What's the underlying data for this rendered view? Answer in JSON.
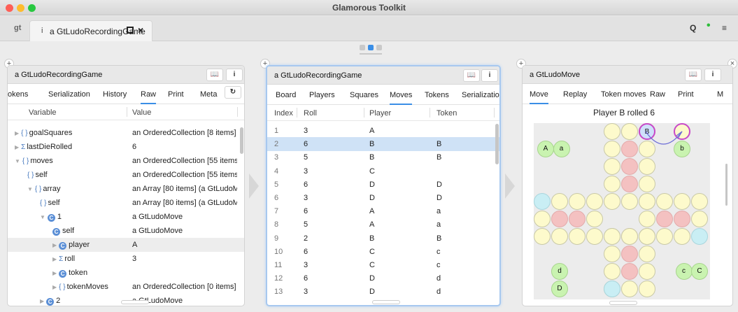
{
  "window": {
    "title": "Glamorous Toolkit",
    "traffic": [
      "#fe5f57",
      "#febc2e",
      "#28c840"
    ]
  },
  "app": {
    "logo": "gt"
  },
  "main_tab": {
    "icon": "i",
    "label": "a GtLudoRecordingGame",
    "maximize_icon": "square-icon",
    "close_icon": "×"
  },
  "toolbar": {
    "search": "Q",
    "status_dot": "•",
    "menu": "≡"
  },
  "colors": {
    "accent": "#3a8ee6",
    "status_dot": "#2dbd3a",
    "selection": "#cfe2f6"
  },
  "pane1": {
    "title": "a GtLudoRecordingGame",
    "buttons": [
      "m",
      "i"
    ],
    "tabs": [
      "okens",
      "Serialization",
      "History",
      "Raw",
      "Print",
      "Meta"
    ],
    "active_tab": "Raw",
    "refresh": "↻",
    "columns": [
      "Variable",
      "Value"
    ],
    "rows": [
      {
        "var": "goalSquares",
        "icon": "{ }",
        "tri": "▶",
        "value": "an OrderedCollection [8 items] (a"
      },
      {
        "var": "lastDieRolled",
        "icon": "Σ",
        "tri": "▶",
        "value": "6"
      },
      {
        "var": "moves",
        "icon": "{ }",
        "tri": "▼",
        "value": "an OrderedCollection [55 items] (a"
      },
      {
        "var": "self",
        "icon": "{ }",
        "tri": "",
        "value": "an OrderedCollection [55 items] (a"
      },
      {
        "var": "array",
        "icon": "{ }",
        "tri": "▼",
        "value": "an Array [80 items] (a GtLudoMov"
      },
      {
        "var": "self",
        "icon": "{ }",
        "tri": "",
        "value": "an Array [80 items] (a GtLudoMov"
      },
      {
        "var": "1",
        "icon": "C",
        "tri": "▼",
        "value": "a GtLudoMove"
      },
      {
        "var": "self",
        "icon": "C",
        "tri": "",
        "value": "a GtLudoMove"
      },
      {
        "var": "player",
        "icon": "C",
        "tri": "▶",
        "value": "A"
      },
      {
        "var": "roll",
        "icon": "Σ",
        "tri": "▶",
        "value": "3"
      },
      {
        "var": "token",
        "icon": "C",
        "tri": "▶",
        "value": ""
      },
      {
        "var": "tokenMoves",
        "icon": "{ }",
        "tri": "▶",
        "value": "an OrderedCollection [0 items] ()"
      },
      {
        "var": "2",
        "icon": "C",
        "tri": "▶",
        "value": "a GtLudoMove"
      }
    ]
  },
  "pane2": {
    "title": "a GtLudoRecordingGame",
    "buttons": [
      "m",
      "i"
    ],
    "tabs": [
      "Board",
      "Players",
      "Squares",
      "Moves",
      "Tokens",
      "Serializatior"
    ],
    "active_tab": "Moves",
    "columns": [
      "Index",
      "Roll",
      "Player",
      "Token"
    ],
    "rows": [
      [
        "1",
        "3",
        "A",
        ""
      ],
      [
        "2",
        "6",
        "B",
        "B"
      ],
      [
        "3",
        "5",
        "B",
        "B"
      ],
      [
        "4",
        "3",
        "C",
        ""
      ],
      [
        "5",
        "6",
        "D",
        "D"
      ],
      [
        "6",
        "3",
        "D",
        "D"
      ],
      [
        "7",
        "6",
        "A",
        "a"
      ],
      [
        "8",
        "5",
        "A",
        "a"
      ],
      [
        "9",
        "2",
        "B",
        "B"
      ],
      [
        "10",
        "6",
        "C",
        "c"
      ],
      [
        "11",
        "3",
        "C",
        "c"
      ],
      [
        "12",
        "6",
        "D",
        "d"
      ],
      [
        "13",
        "3",
        "D",
        "d"
      ]
    ],
    "selected_row": 1
  },
  "pane3": {
    "title": "a GtLudoMove",
    "buttons": [
      "m",
      "i"
    ],
    "tabs": [
      "Move",
      "Replay",
      "Token moves",
      "Raw",
      "Print",
      "M"
    ],
    "active_tab": "Move",
    "board_title": "Player B rolled 6",
    "labels": {
      "A": "A",
      "a": "a",
      "B": "B",
      "b": "b",
      "c": "c",
      "C": "C",
      "d": "d",
      "D": "D"
    },
    "close": "×"
  }
}
